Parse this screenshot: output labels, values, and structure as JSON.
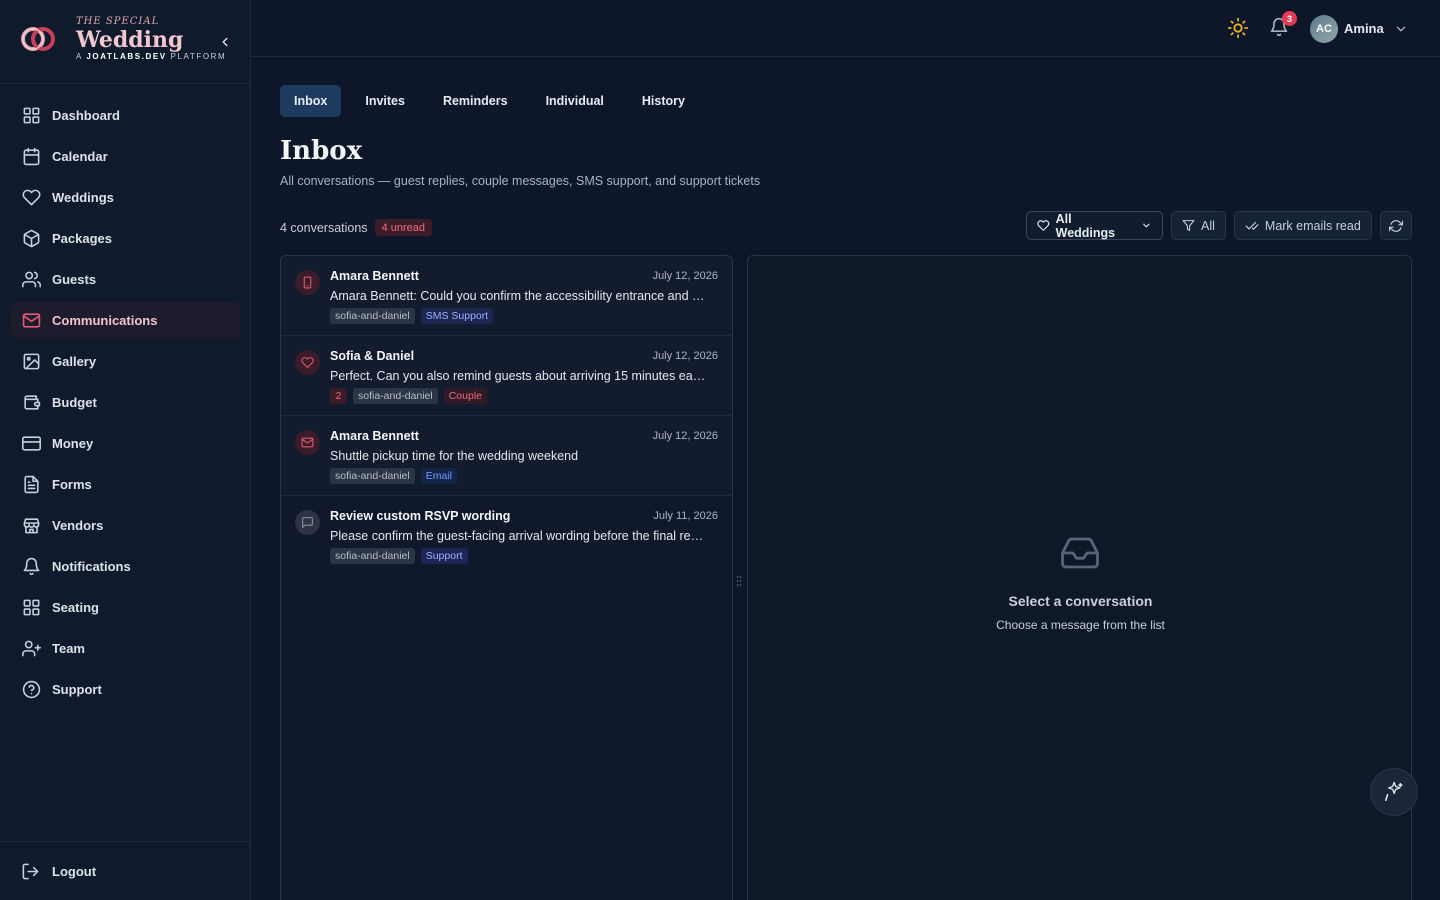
{
  "brand": {
    "top": "THE SPECIAL",
    "main": "Wedding",
    "sub_prefix": "A ",
    "sub_bold": "JOATLABS.DEV",
    "sub_suffix": " PLATFORM"
  },
  "sidebar": {
    "items": [
      {
        "label": "Dashboard",
        "icon": "grid-icon"
      },
      {
        "label": "Calendar",
        "icon": "calendar-icon"
      },
      {
        "label": "Weddings",
        "icon": "heart-icon"
      },
      {
        "label": "Packages",
        "icon": "package-icon"
      },
      {
        "label": "Guests",
        "icon": "users-icon"
      },
      {
        "label": "Communications",
        "icon": "mail-icon",
        "active": true
      },
      {
        "label": "Gallery",
        "icon": "image-icon"
      },
      {
        "label": "Budget",
        "icon": "wallet-icon"
      },
      {
        "label": "Money",
        "icon": "credit-card-icon"
      },
      {
        "label": "Forms",
        "icon": "file-icon"
      },
      {
        "label": "Vendors",
        "icon": "store-icon"
      },
      {
        "label": "Notifications",
        "icon": "bell-icon"
      },
      {
        "label": "Seating",
        "icon": "grid-icon"
      },
      {
        "label": "Team",
        "icon": "user-plus-icon"
      },
      {
        "label": "Support",
        "icon": "help-circle-icon"
      }
    ],
    "logout_label": "Logout"
  },
  "topbar": {
    "notification_count": "3",
    "user_initials": "AC",
    "user_name": "Amina"
  },
  "tabs": [
    {
      "label": "Inbox",
      "active": true
    },
    {
      "label": "Invites"
    },
    {
      "label": "Reminders"
    },
    {
      "label": "Individual"
    },
    {
      "label": "History"
    }
  ],
  "page": {
    "title": "Inbox",
    "subtitle": "All conversations — guest replies, couple messages, SMS support, and support tickets",
    "conversation_count": "4 conversations",
    "unread_label": "4 unread"
  },
  "toolbar": {
    "weddings_filter": "All Weddings",
    "type_filter": "All",
    "mark_read": "Mark emails read"
  },
  "conversations": [
    {
      "name": "Amara Bennett",
      "date": "July 12, 2026",
      "preview": "Amara Bennett: Could you confirm the accessibility entrance and …",
      "slug": "sofia-and-daniel",
      "type": "SMS Support",
      "icon": "phone-icon"
    },
    {
      "name": "Sofia & Daniel",
      "date": "July 12, 2026",
      "preview": "Perfect. Can you also remind guests about arriving 15 minutes ea…",
      "count": "2",
      "slug": "sofia-and-daniel",
      "type": "Couple",
      "icon": "heart-icon"
    },
    {
      "name": "Amara Bennett",
      "date": "July 12, 2026",
      "preview": "Shuttle pickup time for the wedding weekend",
      "slug": "sofia-and-daniel",
      "type": "Email",
      "icon": "mail-icon"
    },
    {
      "name": "Review custom RSVP wording",
      "date": "July 11, 2026",
      "preview": "Please confirm the guest-facing arrival wording before the final re…",
      "slug": "sofia-and-daniel",
      "type": "Support",
      "icon": "message-square-icon"
    }
  ],
  "detail": {
    "empty_title": "Select a conversation",
    "empty_subtitle": "Choose a message from the list"
  },
  "colors": {
    "accent": "#e55876",
    "background": "#0d1729",
    "tab_active": "#1f3a5f"
  }
}
